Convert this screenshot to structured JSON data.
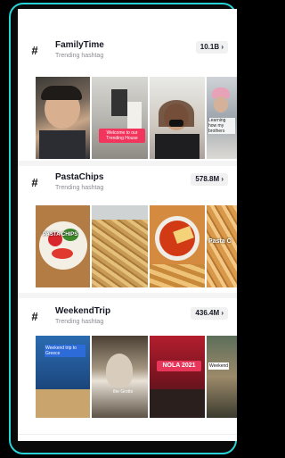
{
  "hashtags": [
    {
      "name": "FamilyTime",
      "subtitle": "Trending hashtag",
      "count": "10.1B ›",
      "captions": [
        "Welcome to our Trending House",
        "Learning how my brothers"
      ]
    },
    {
      "name": "PastaChips",
      "subtitle": "Trending hashtag",
      "count": "578.8M ›",
      "captions": [
        "PASTA CHIPS",
        "Pasta C"
      ]
    },
    {
      "name": "WeekendTrip",
      "subtitle": "Trending hashtag",
      "count": "436.4M ›",
      "captions": [
        "Weekend trip to Greece",
        "the Grotto",
        "NOLA 2021",
        "Weekend"
      ]
    }
  ],
  "colors": {
    "frame": "#27d3d8",
    "accent": "#f2355c",
    "background": "#ffffff"
  }
}
